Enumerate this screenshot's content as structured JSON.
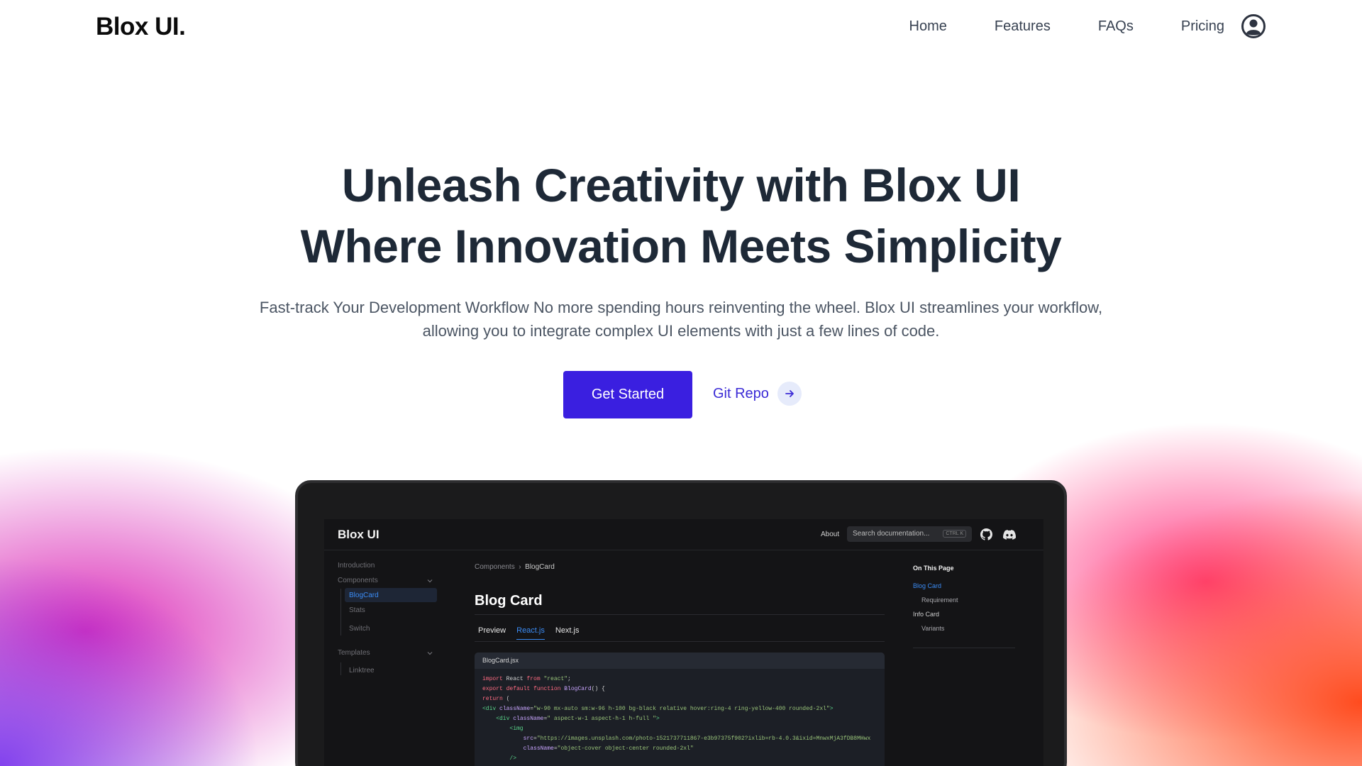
{
  "header": {
    "logo": "Blox UI.",
    "nav": [
      "Home",
      "Features",
      "FAQs",
      "Pricing"
    ],
    "user_icon": "user-circle-icon"
  },
  "hero": {
    "title_line1": "Unleash Creativity with Blox UI",
    "title_line2": "Where Innovation Meets Simplicity",
    "subtitle_line1": "Fast-track Your Development Workflow No more spending hours reinventing the wheel. Blox UI streamlines your workflow,",
    "subtitle_line2": "allowing you to integrate complex UI elements with just a few lines of code.",
    "primary_button": "Get Started",
    "secondary_button": "Git Repo",
    "secondary_icon": "arrow-right-icon"
  },
  "colors": {
    "primary": "#3a1fe0",
    "text_dark": "#1e2937",
    "link": "#3b2bd6"
  },
  "preview": {
    "logo": "Blox UI",
    "about": "About",
    "search_placeholder": "Search documentation...",
    "search_shortcut": "CTRL K",
    "sidebar": {
      "introduction": "Introduction",
      "components": "Components",
      "blogcard": "BlogCard",
      "stats": "Stats",
      "switch": "Switch",
      "templates": "Templates",
      "linktree": "Linktree"
    },
    "breadcrumb": [
      "Components",
      "BlogCard"
    ],
    "page_title": "Blog Card",
    "tabs": [
      "Preview",
      "React.js",
      "Next.js"
    ],
    "code_filename": "BlogCard.jsx",
    "toc": {
      "title": "On This Page",
      "items": [
        "Blog Card",
        "Requirement",
        "Info Card",
        "Variants"
      ]
    }
  }
}
